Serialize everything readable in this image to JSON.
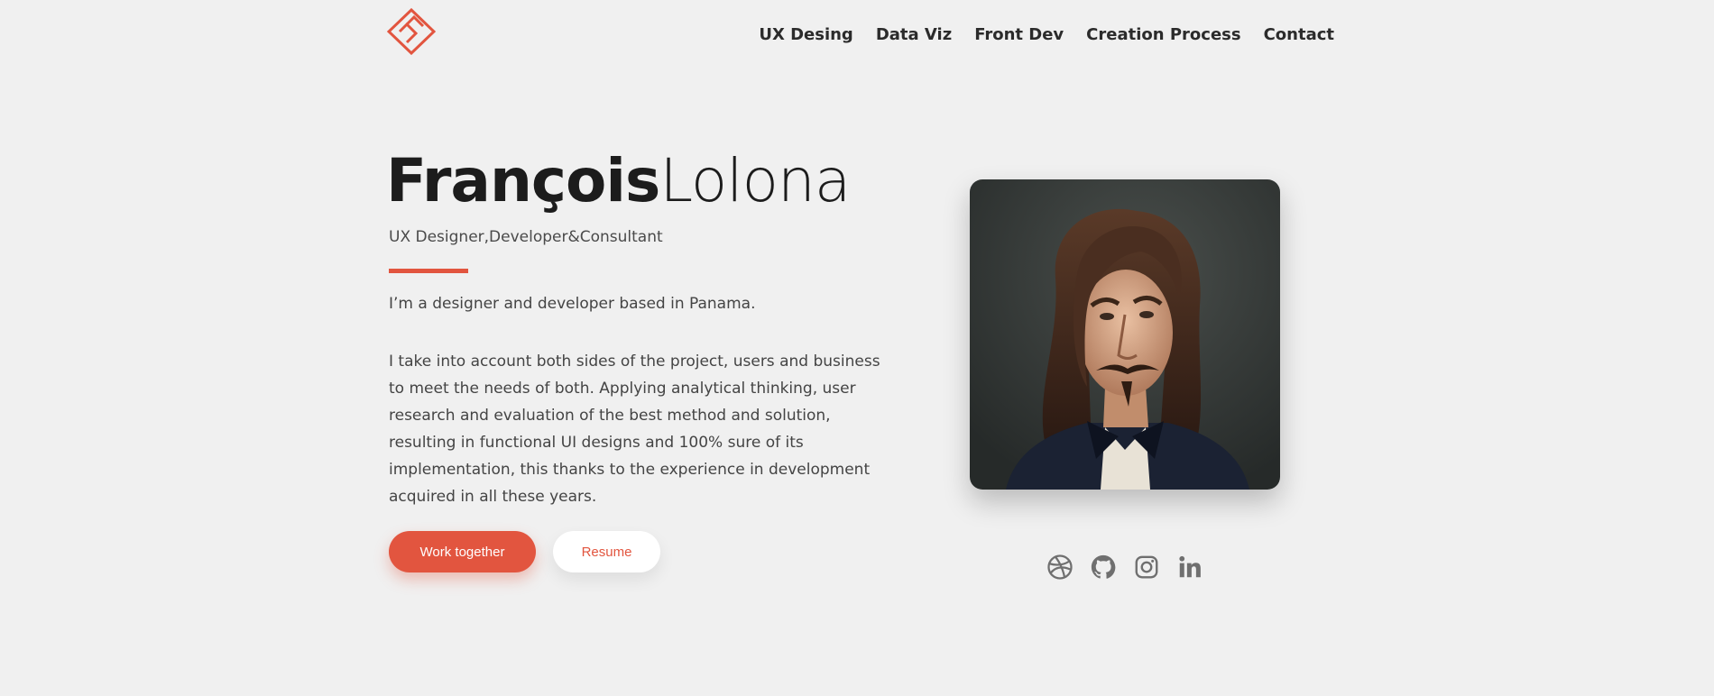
{
  "header": {
    "nav": [
      "UX Desing",
      "Data Viz",
      "Front Dev",
      "Creation Process",
      "Contact"
    ]
  },
  "hero": {
    "first_name": "François",
    "last_name": "Lolona",
    "subtitle": "UX Designer,Developer&Consultant",
    "intro": "I’m a designer and developer based in Panama.",
    "description": "I take into account both sides of the project, users and business to meet the needs of both. Applying analytical thinking, user research and evaluation of the best method and solution, resulting in functional UI designs and 100% sure of its implementation, this thanks to the experience in development acquired in all these years.",
    "primary_button": "Work together",
    "secondary_button": "Resume"
  },
  "social": {
    "icons": [
      "dribbble-icon",
      "github-icon",
      "instagram-icon",
      "linkedin-icon"
    ]
  },
  "colors": {
    "accent": "#e2553f",
    "background": "#f0f0f0",
    "text": "#1c1c1c",
    "icon": "#6f6f6f"
  }
}
